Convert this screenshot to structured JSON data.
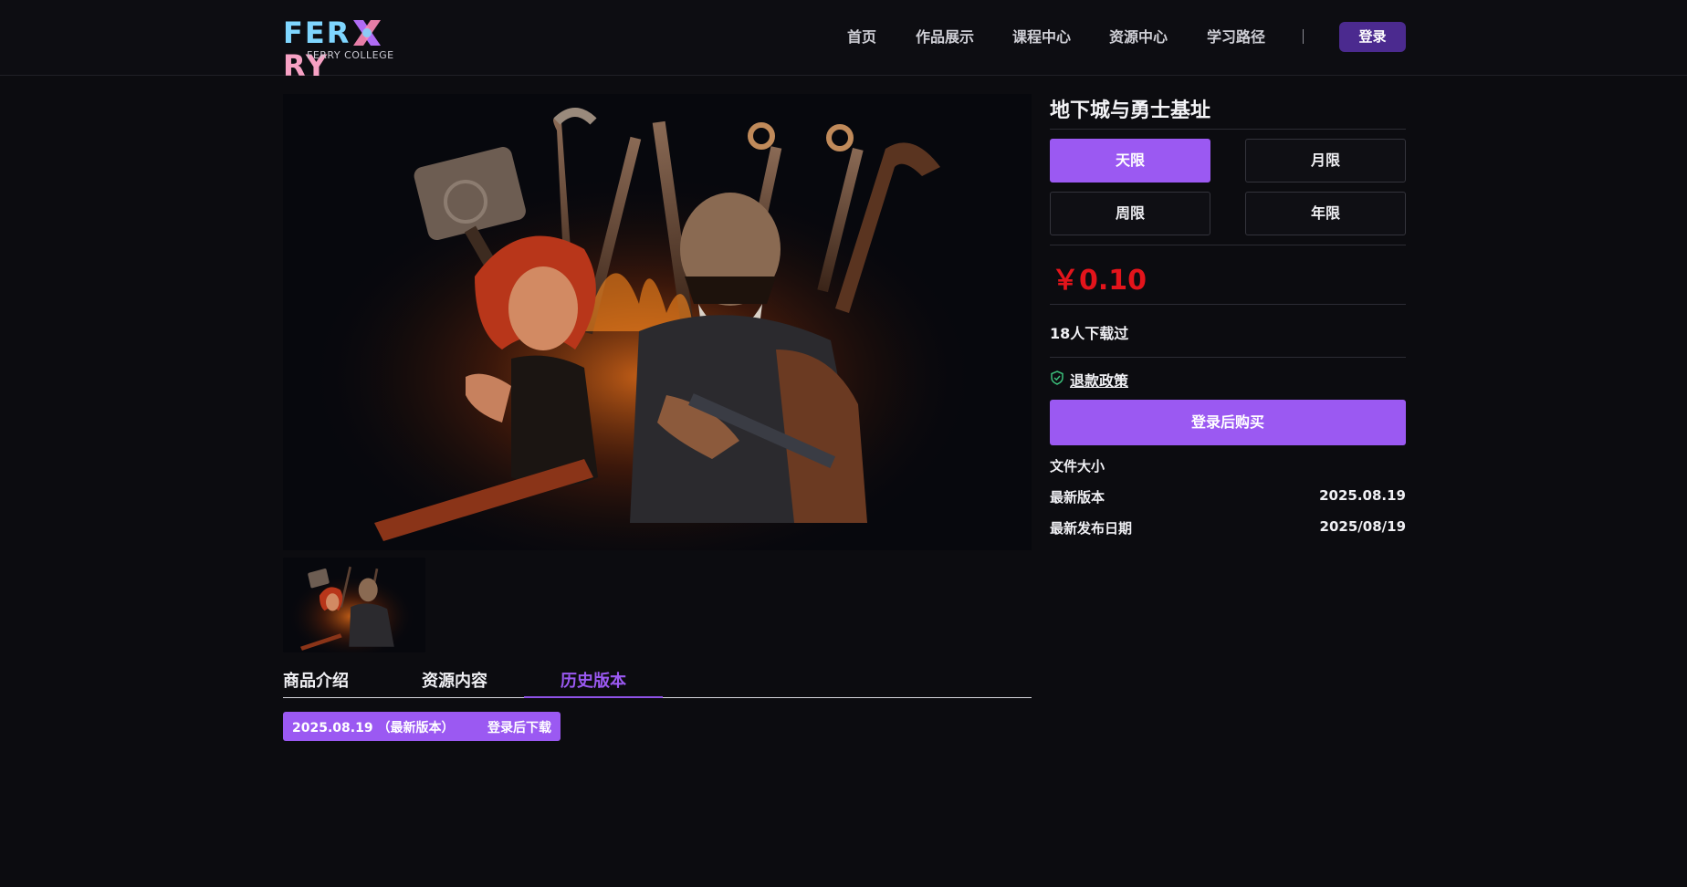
{
  "header": {
    "logo": {
      "word_fe": "FER",
      "word_ry": "RY",
      "sub": "FERRY COLLEGE"
    },
    "nav": [
      {
        "label": "首页"
      },
      {
        "label": "作品展示"
      },
      {
        "label": "课程中心"
      },
      {
        "label": "资源中心"
      },
      {
        "label": "学习路径"
      }
    ],
    "login_label": "登录"
  },
  "product": {
    "title": "地下城与勇士基址",
    "options": [
      {
        "label": "天限",
        "selected": true
      },
      {
        "label": "月限",
        "selected": false
      },
      {
        "label": "周限",
        "selected": false
      },
      {
        "label": "年限",
        "selected": false
      }
    ],
    "price": "￥0.10",
    "downloads": "18人下载过",
    "refund": "退款政策",
    "buy_label": "登录后购买",
    "file_size_label": "文件大小",
    "latest_version_label": "最新版本",
    "latest_version_value": "2025.08.19",
    "release_date_label": "最新发布日期",
    "release_date_value": "2025/08/19"
  },
  "tabs": [
    {
      "label": "商品介绍",
      "active": false
    },
    {
      "label": "资源内容",
      "active": false
    },
    {
      "label": "历史版本",
      "active": true
    }
  ],
  "versions": [
    {
      "label": "2025.08.19 （最新版本）",
      "action": "登录后下载"
    }
  ],
  "colors": {
    "accent": "#9b59f2",
    "price": "#e3141b",
    "login_button": "#4b2a8f",
    "background": "#0c0c10"
  }
}
